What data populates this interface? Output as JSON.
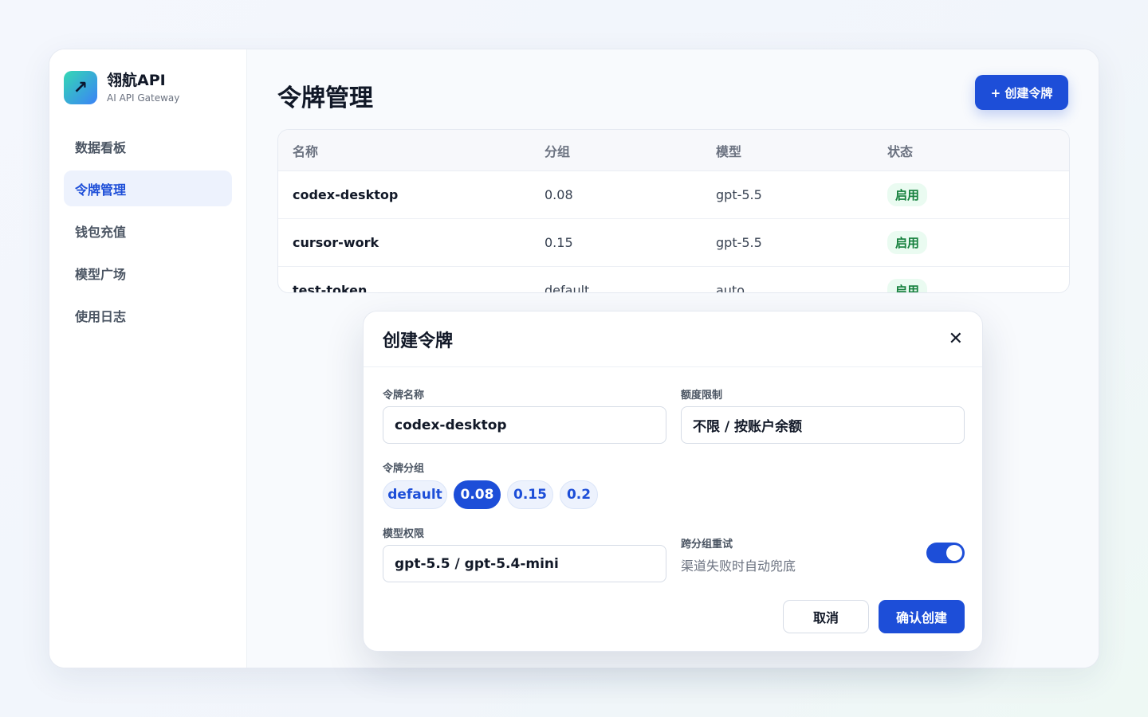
{
  "brand": {
    "name": "翎航API",
    "subtitle": "AI API Gateway",
    "logo_icon": "arrow-up-right-icon"
  },
  "sidebar": {
    "items": [
      {
        "label": "数据看板",
        "active": false
      },
      {
        "label": "令牌管理",
        "active": true
      },
      {
        "label": "钱包充值",
        "active": false
      },
      {
        "label": "模型广场",
        "active": false
      },
      {
        "label": "使用日志",
        "active": false
      }
    ]
  },
  "page": {
    "title": "令牌管理",
    "create_button": "+ 创建令牌"
  },
  "table": {
    "headers": [
      "名称",
      "分组",
      "模型",
      "状态"
    ],
    "rows": [
      {
        "name": "codex-desktop",
        "group": "0.08",
        "model": "gpt-5.5",
        "status": "启用"
      },
      {
        "name": "cursor-work",
        "group": "0.15",
        "model": "gpt-5.5",
        "status": "启用"
      },
      {
        "name": "test-token",
        "group": "default",
        "model": "auto",
        "status": "启用"
      }
    ]
  },
  "modal": {
    "title": "创建令牌",
    "close_icon": "close-icon",
    "token_name_label": "令牌名称",
    "token_name_value": "codex-desktop",
    "quota_label": "额度限制",
    "quota_value": "不限 / 按账户余额",
    "group_label": "令牌分组",
    "groups": [
      "default",
      "0.08",
      "0.15",
      "0.2"
    ],
    "selected_group": "0.08",
    "model_label": "模型权限",
    "model_value": "gpt-5.5 / gpt-5.4-mini",
    "retry_label": "跨分组重试",
    "retry_hint": "渠道失败时自动兜底",
    "retry_enabled": true,
    "cancel_label": "取消",
    "confirm_label": "确认创建"
  },
  "colors": {
    "accent": "#1d4ed8",
    "status_green": "#15803d",
    "logo_start": "#34d8b4",
    "logo_end": "#3b82f6"
  }
}
